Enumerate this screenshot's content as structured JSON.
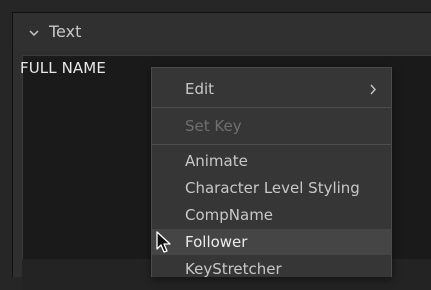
{
  "section": {
    "title": "Text",
    "icon": "chevron-down-icon"
  },
  "text_field": {
    "value": "FULL NAME"
  },
  "context_menu": {
    "items": [
      {
        "label": "Edit",
        "submenu": true,
        "enabled": true
      },
      {
        "label": "Set Key",
        "submenu": false,
        "enabled": false
      },
      {
        "label": "Animate",
        "submenu": false,
        "enabled": true
      },
      {
        "label": "Character Level Styling",
        "submenu": false,
        "enabled": true
      },
      {
        "label": "CompName",
        "submenu": false,
        "enabled": true
      },
      {
        "label": "Follower",
        "submenu": false,
        "enabled": true,
        "highlighted": true
      },
      {
        "label": "KeyStretcher",
        "submenu": false,
        "enabled": true
      }
    ]
  },
  "cursor": {
    "icon": "mouse-pointer-icon"
  },
  "colors": {
    "background": "#262626",
    "panel": "#2f2f2f",
    "field": "#1a1a1a",
    "menu": "#363636",
    "highlight": "#454545",
    "text": "#c8c8c8",
    "disabled_text": "#6f6f6f"
  }
}
